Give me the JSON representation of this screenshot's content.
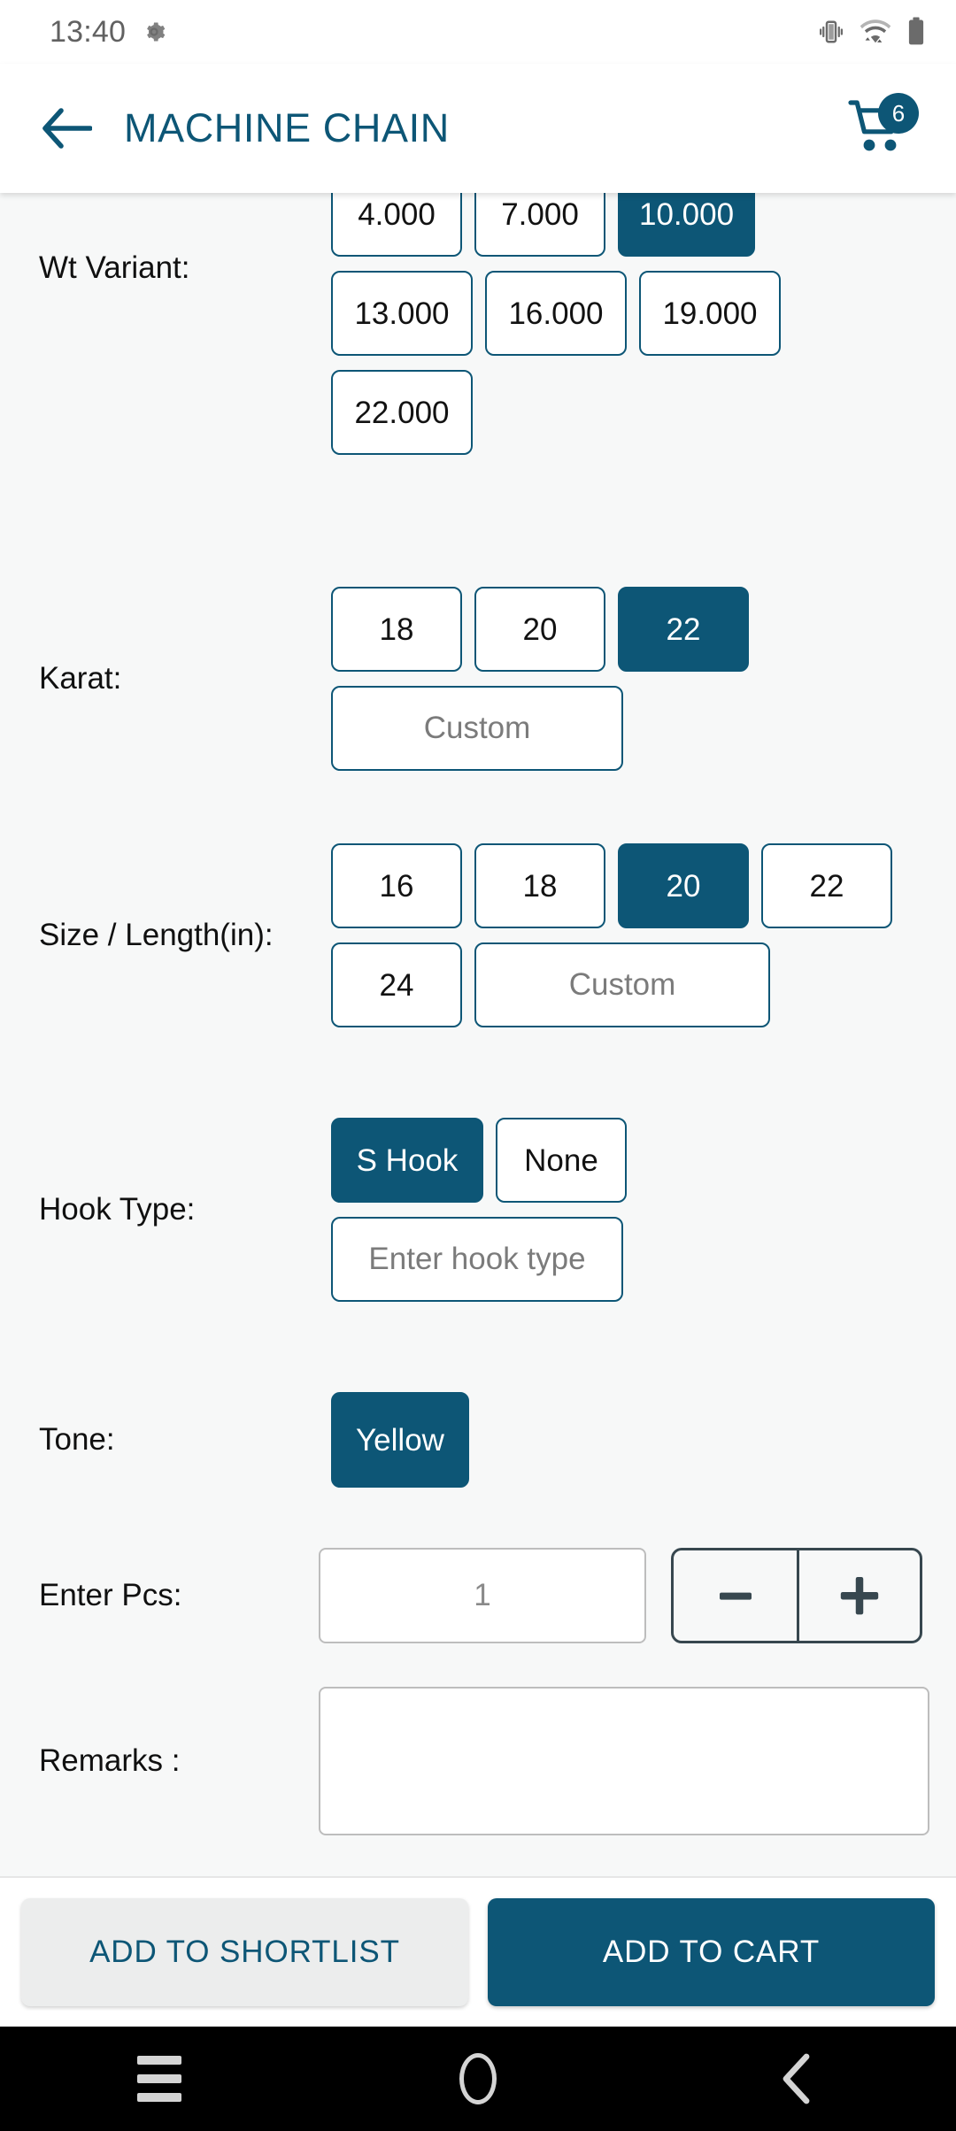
{
  "statusbar": {
    "time": "13:40",
    "icons": [
      "gear-icon",
      "vibrate-icon",
      "wifi-icon",
      "battery-icon"
    ]
  },
  "appbar": {
    "back_icon": "arrow-left-icon",
    "title": "MACHINE CHAIN",
    "cart_icon": "shopping-cart-icon",
    "cart_count": "6"
  },
  "form": {
    "wt_variant": {
      "label": "Wt Variant:",
      "options": [
        "4.000",
        "7.000",
        "10.000",
        "13.000",
        "16.000",
        "19.000",
        "22.000"
      ],
      "selected": "10.000"
    },
    "karat": {
      "label": "Karat:",
      "options": [
        "18",
        "20",
        "22"
      ],
      "selected": "22",
      "custom_placeholder": "Custom",
      "custom_value": ""
    },
    "size_length": {
      "label": "Size / Length(in):",
      "options": [
        "16",
        "18",
        "20",
        "22",
        "24"
      ],
      "selected": "20",
      "custom_placeholder": "Custom",
      "custom_value": ""
    },
    "hook_type": {
      "label": "Hook Type:",
      "options": [
        "S Hook",
        "None"
      ],
      "selected": "S Hook",
      "input_placeholder": "Enter hook type",
      "input_value": ""
    },
    "tone": {
      "label": "Tone:",
      "options": [
        "Yellow"
      ],
      "selected": "Yellow"
    },
    "pcs": {
      "label": "Enter Pcs:",
      "placeholder": "1",
      "value": "",
      "decrement_label": "−",
      "increment_label": "+"
    },
    "remarks": {
      "label": "Remarks :",
      "placeholder": "",
      "value": ""
    }
  },
  "actions": {
    "shortlist_label": "ADD TO SHORTLIST",
    "cart_label": "ADD TO CART"
  },
  "navbar": {
    "recents": "recents-icon",
    "home": "home-icon",
    "back": "back-icon"
  },
  "colors": {
    "accent": "#0d5676",
    "page_bg": "#f7f8f8",
    "chip_border": "#0d5676",
    "stepper_border": "#37474f"
  }
}
